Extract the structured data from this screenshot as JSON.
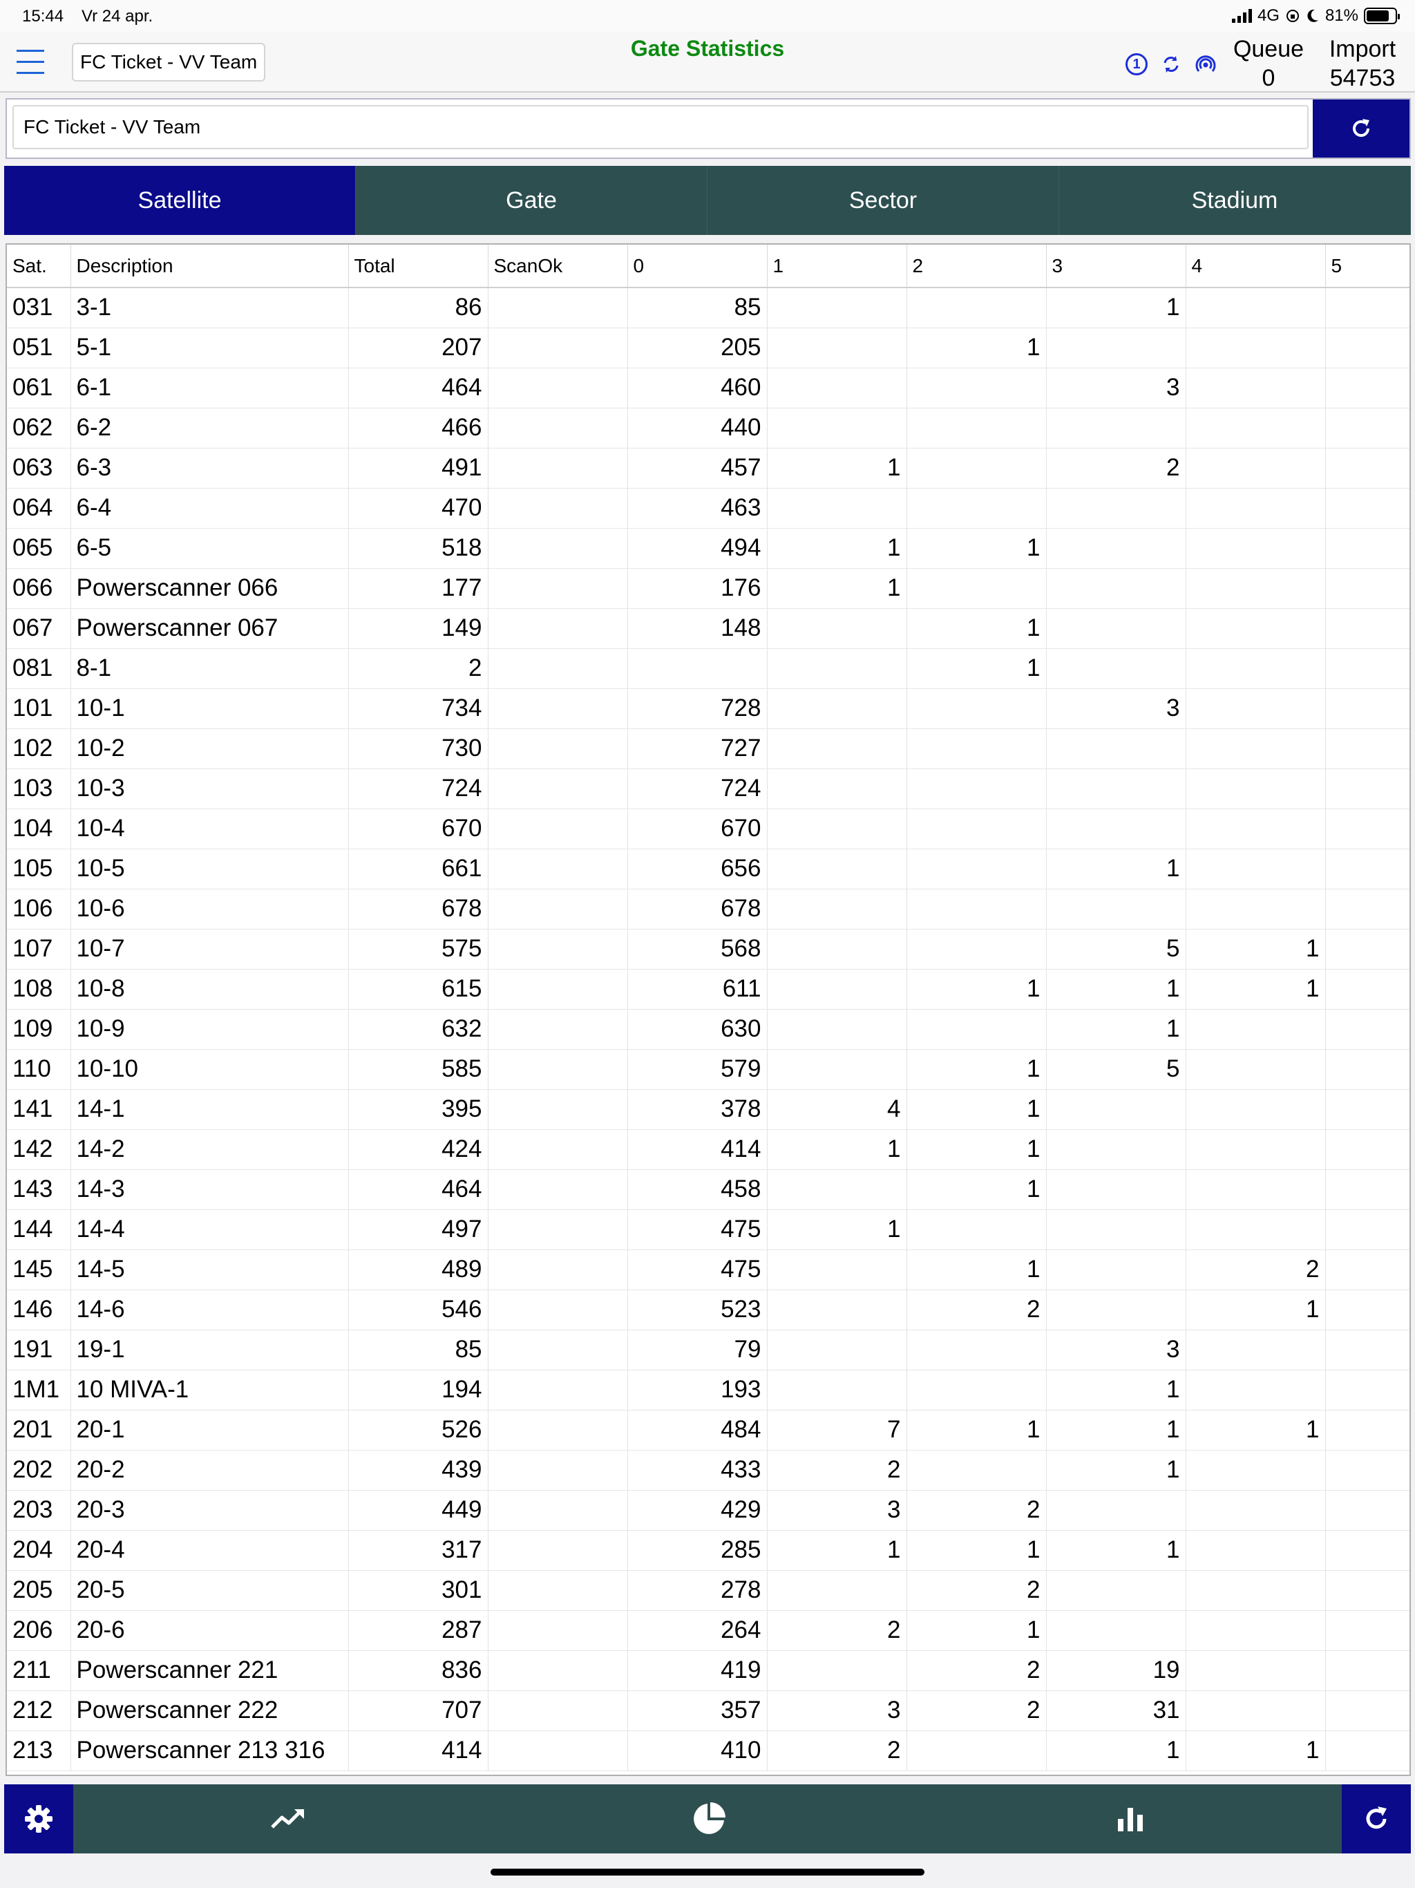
{
  "status_bar": {
    "time": "15:44",
    "date": "Vr 24 apr.",
    "network": "4G",
    "battery": "81%",
    "battery_level": 0.81
  },
  "header": {
    "title": "Gate Statistics",
    "team": "FC Ticket - VV Team",
    "queue_label": "Queue",
    "queue_value": "0",
    "import_label": "Import",
    "import_value": "54753"
  },
  "search": {
    "value": "FC Ticket - VV Team"
  },
  "tabs": [
    {
      "label": "Satellite",
      "active": true
    },
    {
      "label": "Gate",
      "active": false
    },
    {
      "label": "Sector",
      "active": false
    },
    {
      "label": "Stadium",
      "active": false
    }
  ],
  "table": {
    "columns": [
      "Sat.",
      "Description",
      "Total",
      "ScanOk",
      "0",
      "1",
      "2",
      "3",
      "4",
      "5"
    ],
    "rows": [
      [
        "031",
        "3-1",
        "86",
        "",
        "85",
        "",
        "",
        "1",
        "",
        ""
      ],
      [
        "051",
        "5-1",
        "207",
        "",
        "205",
        "",
        "1",
        "",
        "",
        ""
      ],
      [
        "061",
        "6-1",
        "464",
        "",
        "460",
        "",
        "",
        "3",
        "",
        ""
      ],
      [
        "062",
        "6-2",
        "466",
        "",
        "440",
        "",
        "",
        "",
        "",
        ""
      ],
      [
        "063",
        "6-3",
        "491",
        "",
        "457",
        "1",
        "",
        "2",
        "",
        ""
      ],
      [
        "064",
        "6-4",
        "470",
        "",
        "463",
        "",
        "",
        "",
        "",
        ""
      ],
      [
        "065",
        "6-5",
        "518",
        "",
        "494",
        "1",
        "1",
        "",
        "",
        ""
      ],
      [
        "066",
        "Powerscanner 066",
        "177",
        "",
        "176",
        "1",
        "",
        "",
        "",
        ""
      ],
      [
        "067",
        "Powerscanner 067",
        "149",
        "",
        "148",
        "",
        "1",
        "",
        "",
        ""
      ],
      [
        "081",
        "8-1",
        "2",
        "",
        "",
        "",
        "1",
        "",
        "",
        ""
      ],
      [
        "101",
        "10-1",
        "734",
        "",
        "728",
        "",
        "",
        "3",
        "",
        ""
      ],
      [
        "102",
        "10-2",
        "730",
        "",
        "727",
        "",
        "",
        "",
        "",
        ""
      ],
      [
        "103",
        "10-3",
        "724",
        "",
        "724",
        "",
        "",
        "",
        "",
        ""
      ],
      [
        "104",
        "10-4",
        "670",
        "",
        "670",
        "",
        "",
        "",
        "",
        ""
      ],
      [
        "105",
        "10-5",
        "661",
        "",
        "656",
        "",
        "",
        "1",
        "",
        ""
      ],
      [
        "106",
        "10-6",
        "678",
        "",
        "678",
        "",
        "",
        "",
        "",
        ""
      ],
      [
        "107",
        "10-7",
        "575",
        "",
        "568",
        "",
        "",
        "5",
        "1",
        ""
      ],
      [
        "108",
        "10-8",
        "615",
        "",
        "611",
        "",
        "1",
        "1",
        "1",
        ""
      ],
      [
        "109",
        "10-9",
        "632",
        "",
        "630",
        "",
        "",
        "1",
        "",
        ""
      ],
      [
        "110",
        "10-10",
        "585",
        "",
        "579",
        "",
        "1",
        "5",
        "",
        ""
      ],
      [
        "141",
        "14-1",
        "395",
        "",
        "378",
        "4",
        "1",
        "",
        "",
        ""
      ],
      [
        "142",
        "14-2",
        "424",
        "",
        "414",
        "1",
        "1",
        "",
        "",
        ""
      ],
      [
        "143",
        "14-3",
        "464",
        "",
        "458",
        "",
        "1",
        "",
        "",
        ""
      ],
      [
        "144",
        "14-4",
        "497",
        "",
        "475",
        "1",
        "",
        "",
        "",
        ""
      ],
      [
        "145",
        "14-5",
        "489",
        "",
        "475",
        "",
        "1",
        "",
        "2",
        ""
      ],
      [
        "146",
        "14-6",
        "546",
        "",
        "523",
        "",
        "2",
        "",
        "1",
        ""
      ],
      [
        "191",
        "19-1",
        "85",
        "",
        "79",
        "",
        "",
        "3",
        "",
        ""
      ],
      [
        "1M1",
        "10 MIVA-1",
        "194",
        "",
        "193",
        "",
        "",
        "1",
        "",
        ""
      ],
      [
        "201",
        "20-1",
        "526",
        "",
        "484",
        "7",
        "1",
        "1",
        "1",
        ""
      ],
      [
        "202",
        "20-2",
        "439",
        "",
        "433",
        "2",
        "",
        "1",
        "",
        ""
      ],
      [
        "203",
        "20-3",
        "449",
        "",
        "429",
        "3",
        "2",
        "",
        "",
        ""
      ],
      [
        "204",
        "20-4",
        "317",
        "",
        "285",
        "1",
        "1",
        "1",
        "",
        ""
      ],
      [
        "205",
        "20-5",
        "301",
        "",
        "278",
        "",
        "2",
        "",
        "",
        ""
      ],
      [
        "206",
        "20-6",
        "287",
        "",
        "264",
        "2",
        "1",
        "",
        "",
        ""
      ],
      [
        "211",
        "Powerscanner 221",
        "836",
        "",
        "419",
        "",
        "2",
        "19",
        "",
        ""
      ],
      [
        "212",
        "Powerscanner 222",
        "707",
        "",
        "357",
        "3",
        "2",
        "31",
        "",
        ""
      ],
      [
        "213",
        "Powerscanner 213 316",
        "414",
        "",
        "410",
        "2",
        "",
        "1",
        "1",
        ""
      ]
    ]
  },
  "icons": {
    "menu": "menu-icon",
    "info": "info-one-icon",
    "sync": "sync-icon",
    "broadcast": "broadcast-icon",
    "refresh": "refresh-icon",
    "settings": "gear-icon",
    "trend": "trend-icon",
    "pie": "pie-chart-icon",
    "bars": "bar-chart-icon"
  },
  "colors": {
    "accent": "#0a0a8a",
    "bar": "#2e4f50",
    "title": "#0d8a12"
  }
}
